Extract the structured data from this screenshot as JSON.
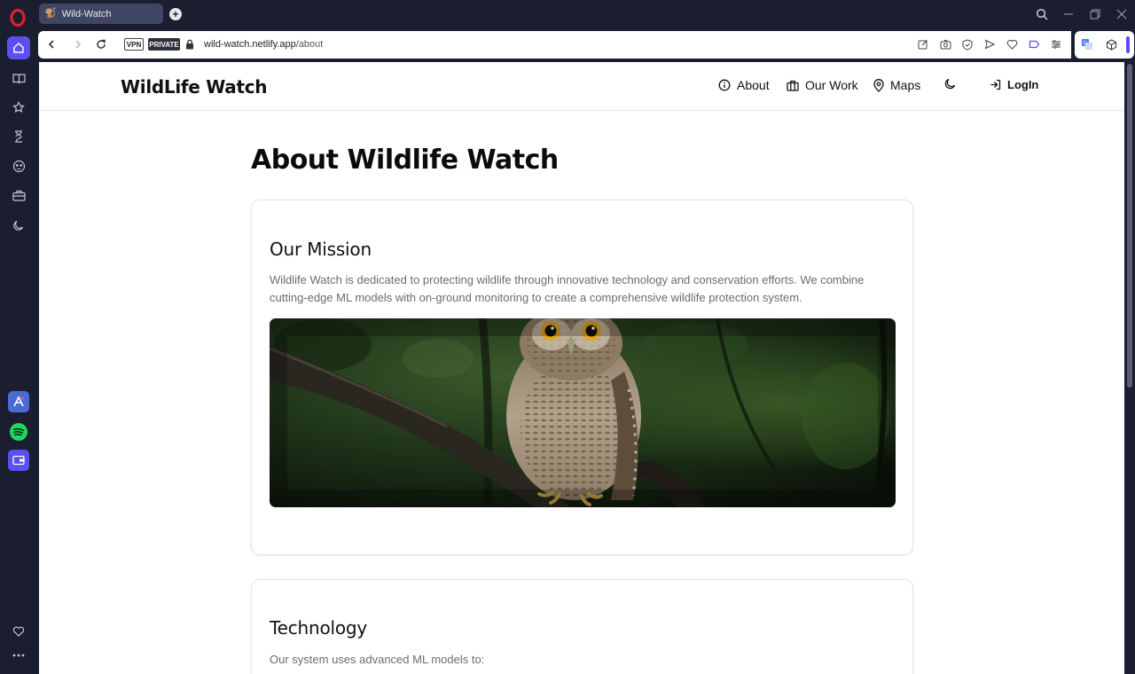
{
  "browser": {
    "tab_title": "Wild-Watch",
    "tab_favicon": "🐒",
    "badge_vpn": "VPN",
    "badge_private": "PRIVATE",
    "url_host": "wild-watch.netlify.app",
    "url_path": "/about",
    "accent_color": "#5b4ff0"
  },
  "sidebar": {
    "items": [
      "home-icon",
      "bookmarks-icon",
      "pinboard-icon",
      "history-icon",
      "extensions-icon",
      "workspaces-icon",
      "dark-mode-icon"
    ],
    "apps": [
      "aria-app-icon",
      "spotify-app-icon",
      "wallet-app-icon"
    ],
    "bottom": [
      "favorites-icon",
      "more-icon"
    ]
  },
  "site": {
    "brand": "WildLife Watch",
    "nav": {
      "about": "About",
      "our_work": "Our Work",
      "maps": "Maps",
      "login": "LogIn"
    }
  },
  "main": {
    "title": "About Wildlife Watch",
    "mission": {
      "heading": "Our Mission",
      "body": "Wildlife Watch is dedicated to protecting wildlife through innovative technology and conservation efforts. We combine cutting-edge ML models with on-ground monitoring to create a comprehensive wildlife protection system."
    },
    "technology": {
      "heading": "Technology",
      "body": "Our system uses advanced ML models to:"
    }
  }
}
